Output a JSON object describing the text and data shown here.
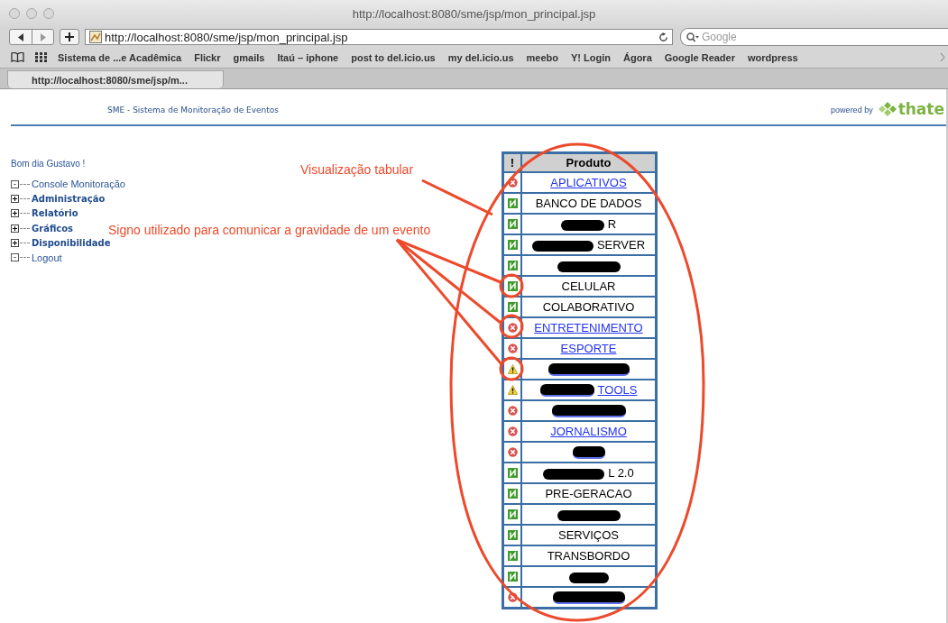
{
  "window": {
    "title": "http://localhost:8080/sme/jsp/mon_principal.jsp"
  },
  "toolbar": {
    "url": "http://localhost:8080/sme/jsp/mon_principal.jsp",
    "search_placeholder": "Google"
  },
  "bookmarks": [
    "Sistema de ...e Acadêmica",
    "Flickr",
    "gmails",
    "Itaú – iphone",
    "post to del.icio.us",
    "my del.icio.us",
    "meebo",
    "Y! Login",
    "Ágora",
    "Google Reader",
    "wordpress"
  ],
  "tabs": [
    {
      "label": "http://localhost:8080/sme/jsp/m...",
      "selected": true
    }
  ],
  "header": {
    "title": "SME - Sistema de Monitoração de Eventos",
    "powered_by": "powered by",
    "brand": "thate"
  },
  "greeting": "Bom dia Gustavo !",
  "menu": [
    {
      "label": "Console Monitoração",
      "kind": "leaf"
    },
    {
      "label": "Administração",
      "kind": "folder"
    },
    {
      "label": "Relatório",
      "kind": "folder"
    },
    {
      "label": "Gráficos",
      "kind": "folder"
    },
    {
      "label": "Disponibilidade",
      "kind": "folder"
    },
    {
      "label": "Logout",
      "kind": "leaf"
    }
  ],
  "table": {
    "columns": [
      "!",
      "Produto"
    ],
    "rows": [
      {
        "kind": "error",
        "text": "APLICATIVOS",
        "link": true
      },
      {
        "kind": "ok",
        "text": "BANCO DE DADOS",
        "link": false
      },
      {
        "kind": "ok",
        "text": "R",
        "link": false,
        "redacted": true
      },
      {
        "kind": "ok",
        "text": "SERVER",
        "link": false,
        "redacted": true
      },
      {
        "kind": "ok",
        "link": false,
        "redacted": true
      },
      {
        "kind": "ok",
        "text": "CELULAR",
        "link": false
      },
      {
        "kind": "ok",
        "text": "COLABORATIVO",
        "link": false
      },
      {
        "kind": "error",
        "text": "ENTRETENIMENTO",
        "link": true
      },
      {
        "kind": "error",
        "text": "ESPORTE",
        "link": true
      },
      {
        "kind": "warning",
        "link": true,
        "redacted": true
      },
      {
        "kind": "warning",
        "text": "TOOLS",
        "link": true,
        "redacted": true
      },
      {
        "kind": "error",
        "link": true,
        "redacted": true
      },
      {
        "kind": "error",
        "text": "JORNALISMO",
        "link": true
      },
      {
        "kind": "error",
        "link": true,
        "redacted": true
      },
      {
        "kind": "ok",
        "text": "L 2.0",
        "link": false,
        "redacted": true
      },
      {
        "kind": "ok",
        "text": "PRE-GERACAO",
        "link": false
      },
      {
        "kind": "ok",
        "link": false,
        "redacted": true
      },
      {
        "kind": "ok",
        "text": "SERVIÇOS",
        "link": false
      },
      {
        "kind": "ok",
        "text": "TRANSBORDO",
        "link": false
      },
      {
        "kind": "ok",
        "link": false,
        "redacted": true
      },
      {
        "kind": "error",
        "link": true,
        "redacted": true
      }
    ]
  },
  "annotations": [
    "Visualização tabular",
    "Signo utilizado para comunicar a gravidade de um evento"
  ]
}
